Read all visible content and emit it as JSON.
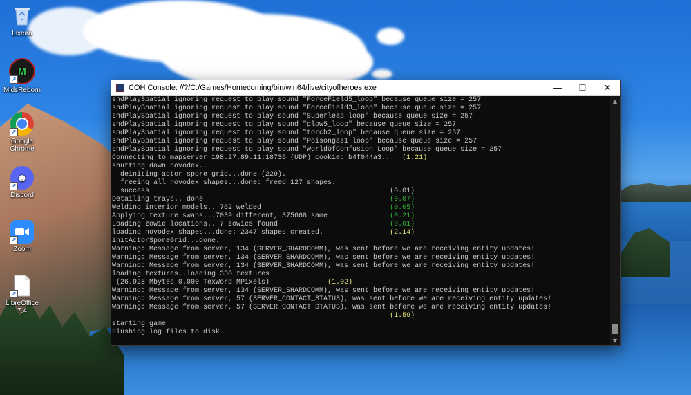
{
  "desktop": {
    "icons": [
      {
        "label": "Lixeira",
        "icon": "recycle-bin-icon"
      },
      {
        "label": "MidsReborn",
        "icon": "midsreborn-app-icon"
      },
      {
        "label": "Google Chrome",
        "icon": "chrome-icon"
      },
      {
        "label": "Discord",
        "icon": "discord-icon"
      },
      {
        "label": "Zoom",
        "icon": "zoom-icon"
      },
      {
        "label": "LibreOffice 7.4",
        "icon": "libreoffice-icon"
      }
    ]
  },
  "window": {
    "title": "COH Console: //?/C:/Games/Homecoming/bin/win64/live/cityofheroes.exe",
    "minimize_glyph": "—",
    "maximize_glyph": "☐",
    "close_glyph": "✕"
  },
  "console": {
    "lines": [
      {
        "text": "sndPlaySpatial ignoring request to play sound \"ForceField5_loop\" because queue size = 257",
        "tag": "",
        "tag_color": ""
      },
      {
        "text": "sndPlaySpatial ignoring request to play sound \"ForceField3_loop\" because queue size = 257",
        "tag": "",
        "tag_color": ""
      },
      {
        "text": "sndPlaySpatial ignoring request to play sound \"Superleap_loop\" because queue size = 257",
        "tag": "",
        "tag_color": ""
      },
      {
        "text": "sndPlaySpatial ignoring request to play sound \"glow5_loop\" because queue size = 257",
        "tag": "",
        "tag_color": ""
      },
      {
        "text": "sndPlaySpatial ignoring request to play sound \"torch2_loop\" because queue size = 257",
        "tag": "",
        "tag_color": ""
      },
      {
        "text": "sndPlaySpatial ignoring request to play sound \"Poisongas1_loop\" because queue size = 257",
        "tag": "",
        "tag_color": ""
      },
      {
        "text": "sndPlaySpatial ignoring request to play sound \"WorldOfConfusion_Loop\" because queue size = 257",
        "tag": "",
        "tag_color": ""
      },
      {
        "text": "Connecting to mapserver 198.27.89.11:18736 (UDP) cookie: b4f044a3..   ",
        "tag": "(1.21)",
        "tag_color": "yellow"
      },
      {
        "text": "shutting down novodex..",
        "tag": "",
        "tag_color": ""
      },
      {
        "text": "  deiniting actor spore grid...done (229).",
        "tag": "",
        "tag_color": ""
      },
      {
        "text": "  freeing all novodex shapes...done: freed 127 shapes.",
        "tag": "",
        "tag_color": ""
      },
      {
        "text": "  success                                                          ",
        "tag": "(0.01)",
        "tag_color": "white"
      },
      {
        "text": "Detailing trays.. done                                             ",
        "tag": "(0.07)",
        "tag_color": "green"
      },
      {
        "text": "Welding interior models.. 762 welded                               ",
        "tag": "(0.05)",
        "tag_color": "green"
      },
      {
        "text": "Applying texture swaps...7039 different, 375668 same               ",
        "tag": "(0.21)",
        "tag_color": "green"
      },
      {
        "text": "Loading zowie locations.. 7 zowies found                           ",
        "tag": "(0.01)",
        "tag_color": "green"
      },
      {
        "text": "loading novodex shapes...done: 2347 shapes created.                ",
        "tag": "(2.14)",
        "tag_color": "yellow"
      },
      {
        "text": "initActorSporeGrid...done.",
        "tag": "",
        "tag_color": ""
      },
      {
        "text": "Warning: Message from server, 134 (SERVER_SHARDCOMM), was sent before we are receiving entity updates!",
        "tag": "",
        "tag_color": ""
      },
      {
        "text": "Warning: Message from server, 134 (SERVER_SHARDCOMM), was sent before we are receiving entity updates!",
        "tag": "",
        "tag_color": ""
      },
      {
        "text": "Warning: Message from server, 134 (SERVER_SHARDCOMM), was sent before we are receiving entity updates!",
        "tag": "",
        "tag_color": ""
      },
      {
        "text": "loading textures..loading 330 textures",
        "tag": "",
        "tag_color": ""
      },
      {
        "text": " (26.928 Mbytes 0.000 TexWord MPixels)              ",
        "tag": "(1.02)",
        "tag_color": "yellow"
      },
      {
        "text": "Warning: Message from server, 134 (SERVER_SHARDCOMM), was sent before we are receiving entity updates!",
        "tag": "",
        "tag_color": ""
      },
      {
        "text": "Warning: Message from server, 57 (SERVER_CONTACT_STATUS), was sent before we are receiving entity updates!",
        "tag": "",
        "tag_color": ""
      },
      {
        "text": "Warning: Message from server, 57 (SERVER_CONTACT_STATUS), was sent before we are receiving entity updates!",
        "tag": "",
        "tag_color": ""
      },
      {
        "text": "                                                                   ",
        "tag": "(1.59)",
        "tag_color": "yellow"
      },
      {
        "text": "starting game",
        "tag": "",
        "tag_color": ""
      },
      {
        "text": "Flushing log files to disk",
        "tag": "",
        "tag_color": ""
      }
    ]
  },
  "colors": {
    "console_bg": "#0c0c0c",
    "console_text": "#c8c8c8",
    "tag_yellow": "#e3e07a",
    "tag_green": "#36b33a"
  }
}
